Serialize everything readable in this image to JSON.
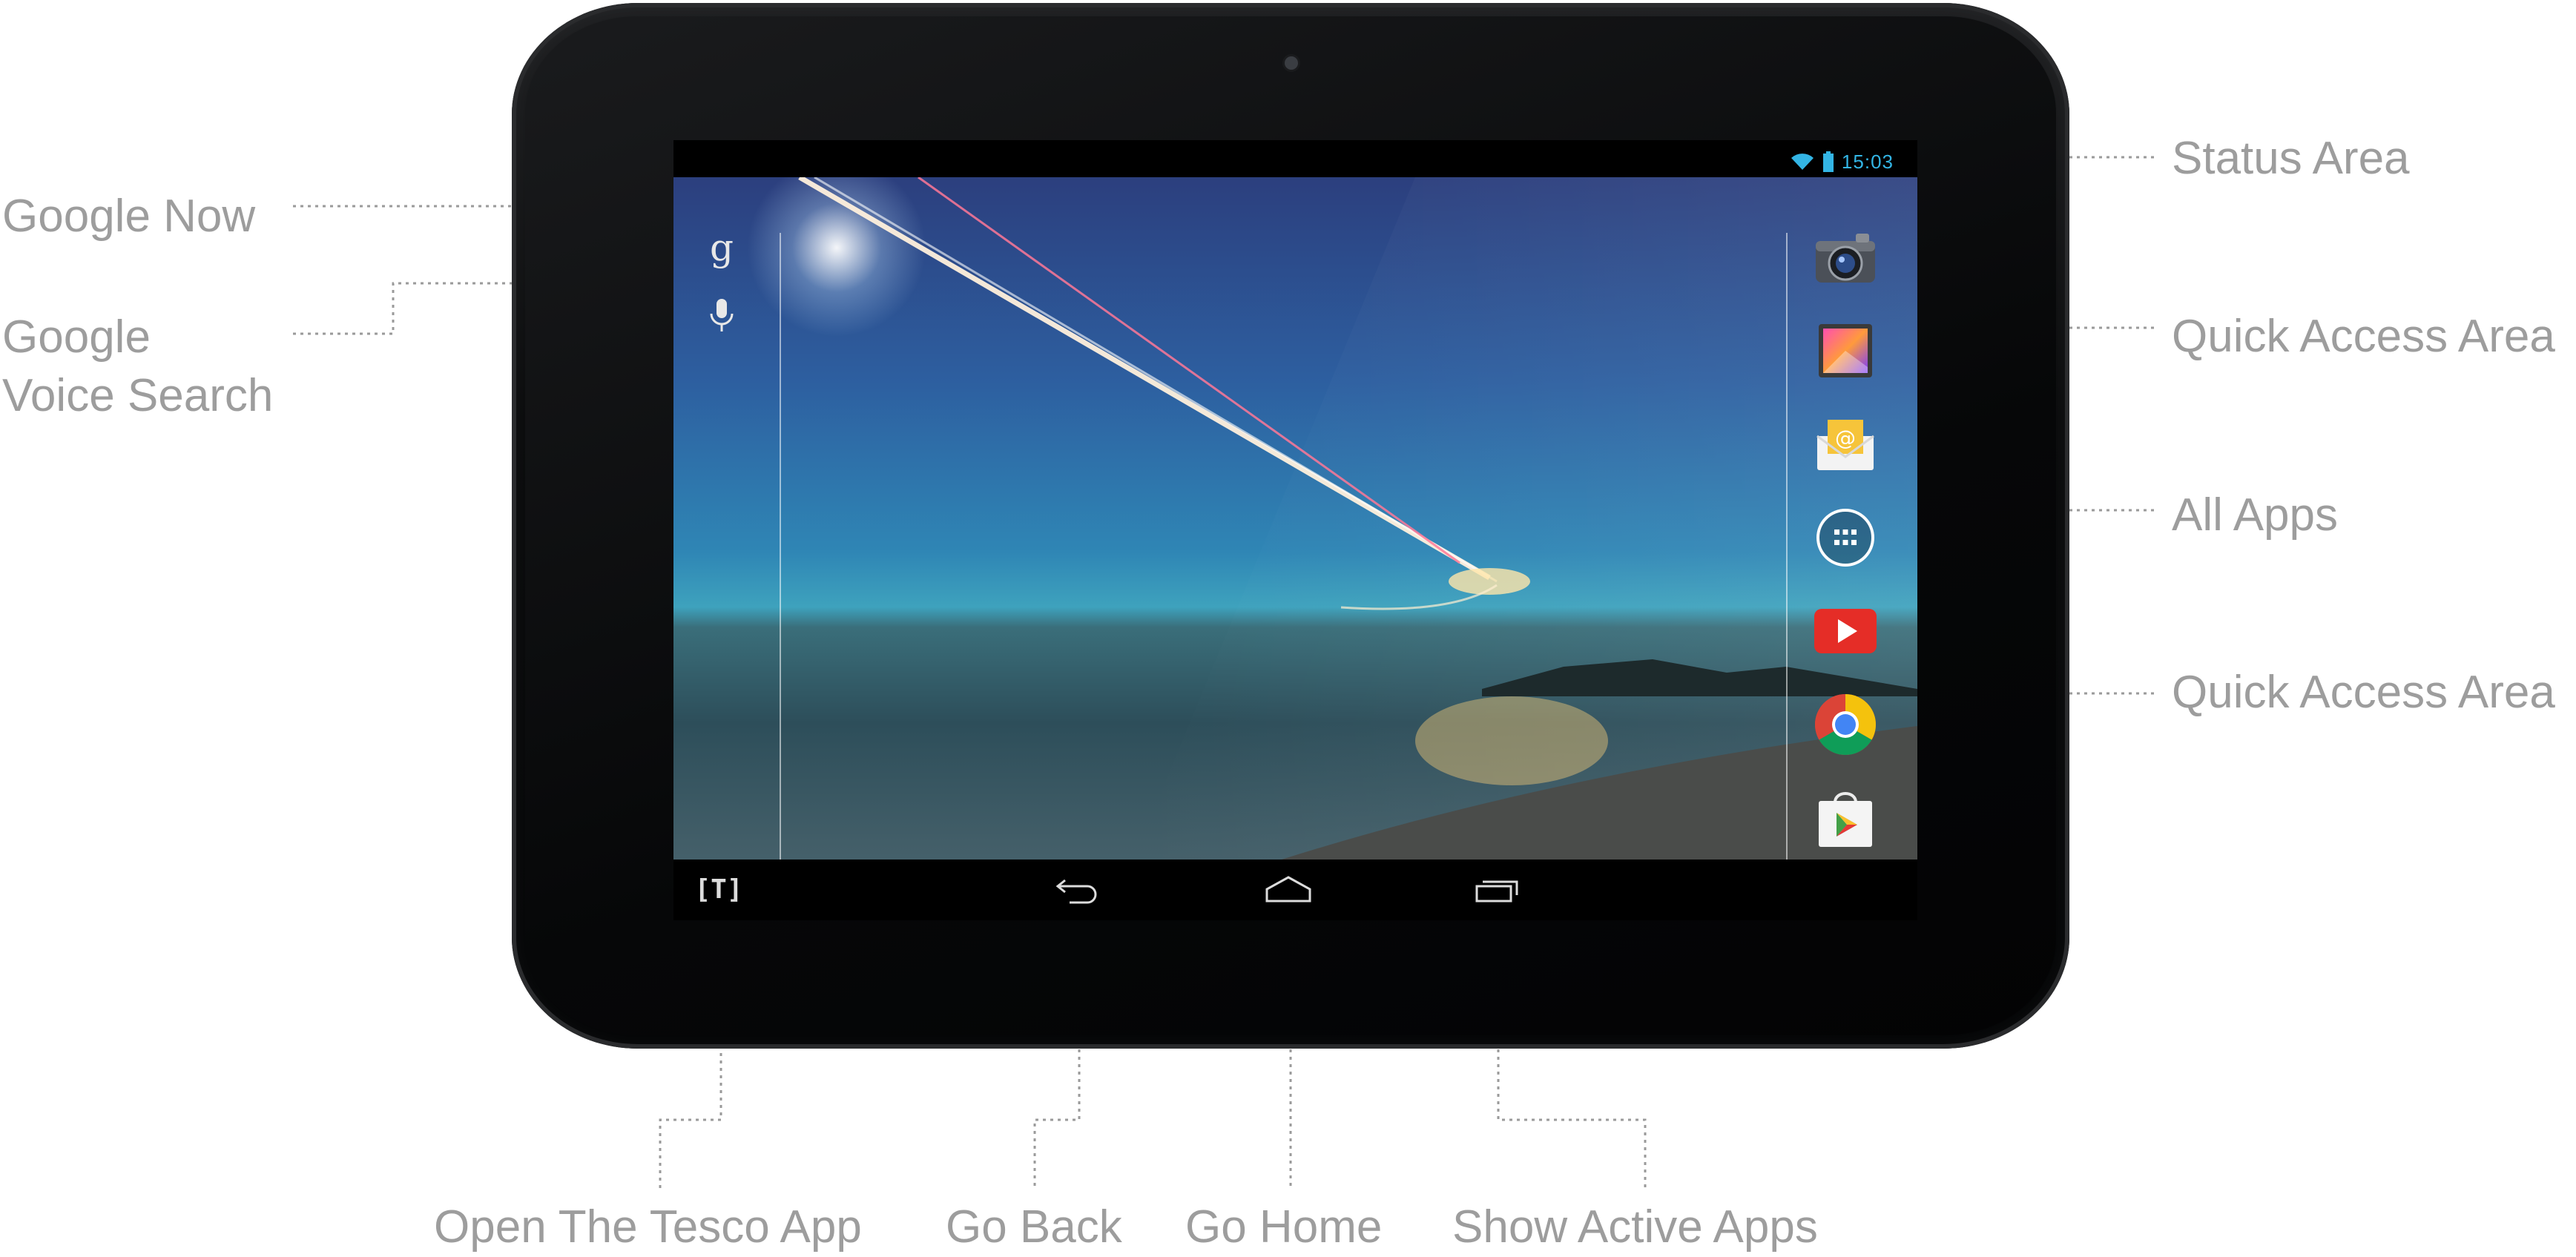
{
  "callouts": {
    "google_now": "Google Now",
    "voice_search_line1": "Google",
    "voice_search_line2": "Voice Search",
    "status_area": "Status Area",
    "quick_access_top": "Quick Access Area",
    "all_apps": "All Apps",
    "quick_access_bottom": "Quick Access Area",
    "open_tesco": "Open The Tesco App",
    "go_back": "Go Back",
    "go_home": "Go Home",
    "show_active_apps": "Show Active Apps"
  },
  "status": {
    "time": "15:03"
  },
  "nav": {
    "tesco_label": "[T]"
  },
  "search": {
    "google_letter": "g"
  },
  "dock": {
    "top_apps": [
      "camera-app",
      "gallery-app",
      "email-app"
    ],
    "all_apps": "all-apps-button",
    "bottom_apps": [
      "youtube-app",
      "chrome-app",
      "play-store-app"
    ]
  },
  "colors": {
    "callout_text": "#9d9d9d",
    "status_accent": "#33b5e5",
    "youtube_red": "#e52d27",
    "chrome_red": "#db4437",
    "chrome_yellow": "#f4c20d",
    "chrome_green": "#0f9d58",
    "chrome_blue": "#4285f4"
  }
}
